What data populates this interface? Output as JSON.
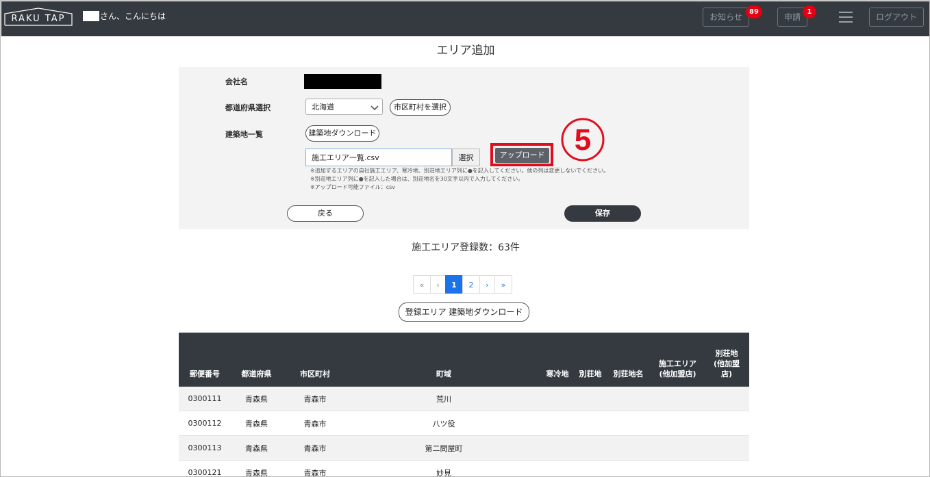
{
  "header": {
    "logo": "RAKU TAP",
    "greeting": "さん、こんにちは",
    "notice_label": "お知らせ",
    "notice_count": "89",
    "apply_label": "申請",
    "apply_count": "1",
    "logout_label": "ログアウト"
  },
  "page": {
    "title": "エリア追加"
  },
  "form": {
    "company_label": "会社名",
    "pref_label": "都道府県選択",
    "pref_value": "北海道",
    "city_button": "市区町村を選択",
    "site_label": "建築地一覧",
    "site_download_button": "建築地ダウンロード",
    "file_value": "施工エリア一覧.csv",
    "choose_button": "選択",
    "upload_button": "アップロード",
    "step_marker": "5",
    "notes": [
      "※追加するエリアの自社施工エリア、寒冷地、別荘地エリア列に●を記入してください。他の列は変更しないでください。",
      "※別荘地エリア列に●を記入した場合は、別荘地名を30文字以内で入力してください。",
      "※アップロード可能ファイル：csv"
    ],
    "back_button": "戻る",
    "save_button": "保存"
  },
  "summary": {
    "count_text": "施工エリア登録数：63件"
  },
  "pagination": {
    "first": "«",
    "prev": "‹",
    "pages": [
      "1",
      "2"
    ],
    "next": "›",
    "last": "»",
    "current": "1"
  },
  "registered_download_button": "登録エリア 建築地ダウンロード",
  "table": {
    "headers": [
      "郵便番号",
      "都道府県",
      "市区町村",
      "町域",
      "寒冷地",
      "別荘地",
      "別荘地名",
      "施工エリア\n(他加盟店)",
      "別荘地\n(他加盟\n店)"
    ],
    "rows": [
      [
        "0300111",
        "青森県",
        "青森市",
        "荒川",
        "",
        "",
        "",
        "",
        ""
      ],
      [
        "0300112",
        "青森県",
        "青森市",
        "八ツ役",
        "",
        "",
        "",
        "",
        ""
      ],
      [
        "0300113",
        "青森県",
        "青森市",
        "第二問屋町",
        "",
        "",
        "",
        "",
        ""
      ],
      [
        "0300121",
        "青森県",
        "青森市",
        "妙見",
        "",
        "",
        "",
        "",
        ""
      ]
    ]
  },
  "colors": {
    "header_bg": "#343a40",
    "badge": "#e00012",
    "highlight": "#e30c1c",
    "primary": "#1a73e8"
  }
}
